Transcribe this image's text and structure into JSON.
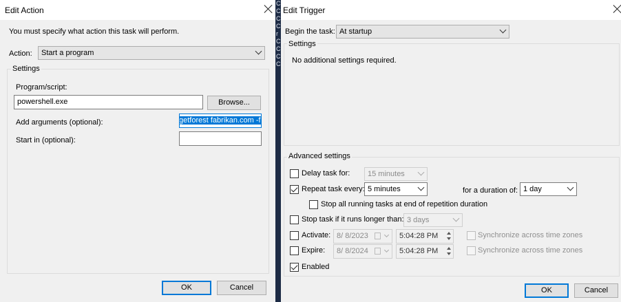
{
  "edit_action": {
    "title": "Edit Action",
    "instruction": "You must specify what action this task will perform.",
    "action_label": "Action:",
    "action_value": "Start a program",
    "settings_group": "Settings",
    "program_label": "Program/script:",
    "program_value": "powershell.exe",
    "browse_label": "Browse...",
    "args_label": "Add arguments (optional):",
    "args_value": "getforest fabrikan.com -f",
    "startin_label": "Start in (optional):",
    "startin_value": "",
    "ok_label": "OK",
    "cancel_label": "Cancel"
  },
  "edit_trigger": {
    "title": "Edit Trigger",
    "begin_label": "Begin the task:",
    "begin_value": "At startup",
    "settings_group": "Settings",
    "settings_note": "No additional settings required.",
    "advanced_group": "Advanced settings",
    "delay_label": "Delay task for:",
    "delay_value": "15 minutes",
    "delay_checked": false,
    "repeat_label": "Repeat task every:",
    "repeat_value": "5 minutes",
    "repeat_checked": true,
    "duration_label": "for a duration of:",
    "duration_value": "1 day",
    "stop_all_label": "Stop all running tasks at end of repetition duration",
    "stop_all_checked": false,
    "stop_longer_label": "Stop task if it runs longer than:",
    "stop_longer_value": "3 days",
    "stop_longer_checked": false,
    "activate_label": "Activate:",
    "activate_date": "8/ 8/2023",
    "activate_time": "5:04:28 PM",
    "activate_checked": false,
    "expire_label": "Expire:",
    "expire_date": "8/ 8/2024",
    "expire_time": "5:04:28 PM",
    "expire_checked": false,
    "sync_label": "Synchronize across time zones",
    "sync_label_2": "Synchronize across time zones",
    "enabled_label": "Enabled",
    "enabled_checked": true,
    "ok_label": "OK",
    "cancel_label": "Cancel"
  },
  "background_strip_letters": [
    "C",
    "C",
    "C",
    "C",
    "r",
    "C",
    "C",
    "C",
    "C"
  ],
  "colors": {
    "accent": "#0078d7",
    "dialog_bg": "#f0f0f0"
  }
}
